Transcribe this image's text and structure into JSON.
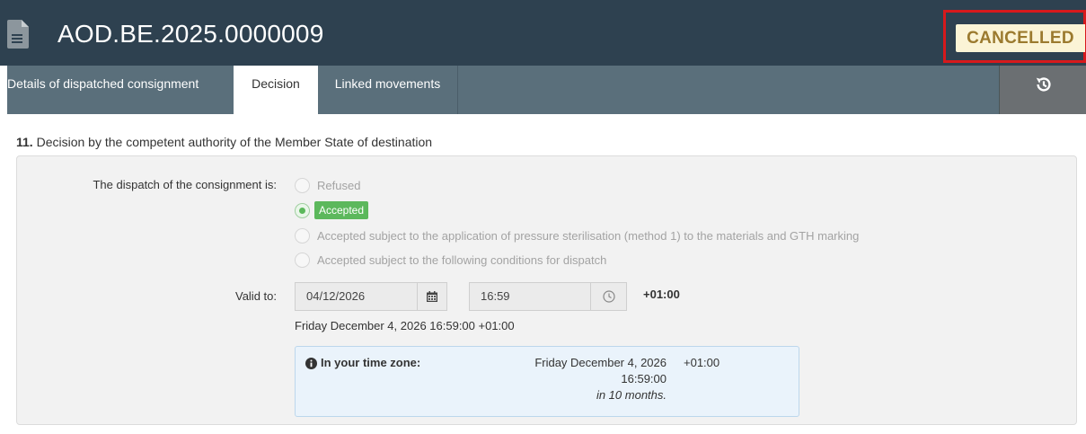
{
  "header": {
    "title": "AOD.BE.2025.0000009",
    "status": "CANCELLED",
    "icon": "document-icon"
  },
  "tabs": [
    {
      "label": "Details of dispatched consignment"
    },
    {
      "label": "Decision",
      "active": true
    },
    {
      "label": "Linked movements"
    }
  ],
  "history_icon": "history-icon",
  "section": {
    "number": "11.",
    "title": "Decision by the competent authority of the Member State of destination"
  },
  "decision": {
    "label": "The dispatch of the consignment is:",
    "options": [
      {
        "label": "Refused",
        "checked": false
      },
      {
        "label": "Accepted",
        "checked": true
      },
      {
        "label": "Accepted subject to the application of pressure sterilisation (method 1) to the materials and GTH marking",
        "checked": false
      },
      {
        "label": "Accepted subject to the following conditions for dispatch",
        "checked": false
      }
    ]
  },
  "valid_to": {
    "label": "Valid to:",
    "date": "04/12/2026",
    "time": "16:59",
    "timezone": "+01:00",
    "long_text": "Friday December 4, 2026 16:59:00 +01:00"
  },
  "timezone_info": {
    "label": "In your time zone:",
    "date": "Friday December 4, 2026",
    "time": "16:59:00",
    "relative": "in 10 months.",
    "offset": "+01:00"
  },
  "colors": {
    "header_bg": "#2e4150",
    "tabbar_bg": "#5a6f7b",
    "status_text": "#9b7a2e",
    "status_bg": "#fbf4d6",
    "highlight_frame": "#d7191c",
    "accepted_green": "#5cb85c"
  }
}
